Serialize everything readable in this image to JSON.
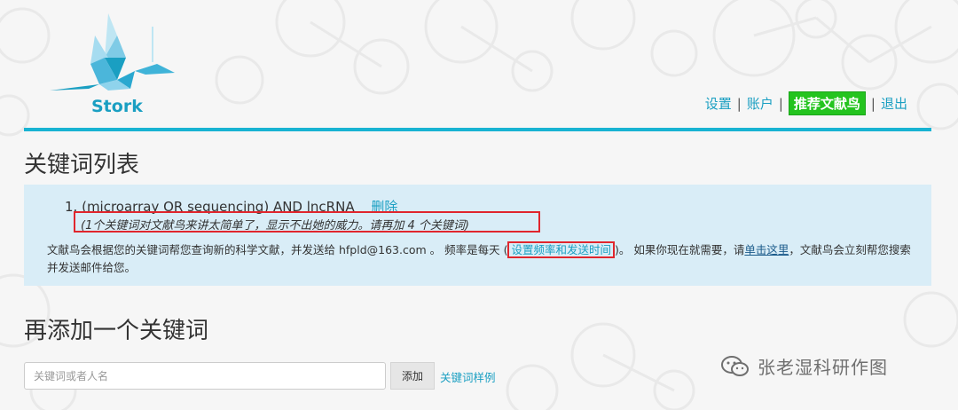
{
  "brand": {
    "name": "Stork"
  },
  "topnav": {
    "settings": "设置",
    "account": "账户",
    "recommend": "推荐文献鸟",
    "logout": "退出",
    "separator": "|"
  },
  "keywords_section": {
    "title": "关键词列表",
    "items": [
      {
        "number": "1.",
        "query": "(microarray OR sequencing) AND lncRNA",
        "delete_label": "删除"
      }
    ],
    "warning": "(1个关键词对文献鸟来讲太简单了，显示不出她的威力。请再加 4 个关键词)",
    "desc_prefix": "文献鸟会根据您的关键词帮您查询新的科学文献，并发送给 hfpld@163.com 。 频率是每天 (",
    "freq_link": "设置频率和发送时间",
    "desc_mid": ")。 如果你现在就需要，请",
    "click_here": "单击这里",
    "desc_suffix": "，文献鸟会立刻帮您搜索并发送邮件给您。"
  },
  "add_section": {
    "title": "再添加一个关键词",
    "input_placeholder": "关键词或者人名",
    "add_button": "添加",
    "examples_link": "关键词样例"
  },
  "watermark": {
    "text": "张老湿科研作图"
  },
  "colors": {
    "accent": "#18b3d2",
    "link": "#1a9fc2",
    "highlight": "#e0262d",
    "recommend": "#24c41f",
    "info_bg": "#d9edf7"
  }
}
